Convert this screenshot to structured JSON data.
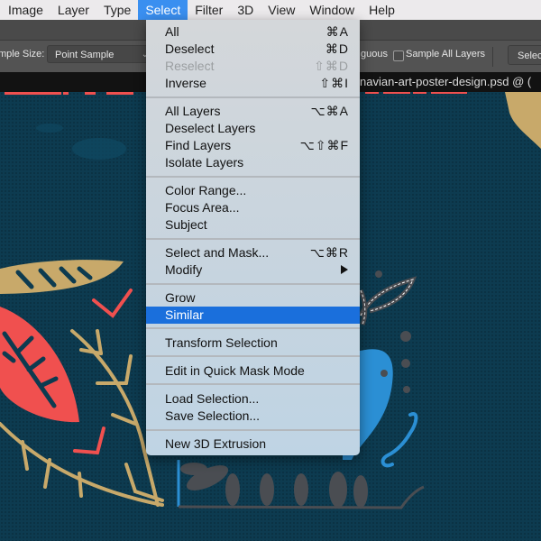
{
  "menubar": {
    "items": [
      {
        "label": "Image"
      },
      {
        "label": "Layer"
      },
      {
        "label": "Type"
      },
      {
        "label": "Select",
        "active": true
      },
      {
        "label": "Filter"
      },
      {
        "label": "3D"
      },
      {
        "label": "View"
      },
      {
        "label": "Window"
      },
      {
        "label": "Help"
      }
    ]
  },
  "options_bar": {
    "sample_size_label": "mple Size:",
    "sample_size_value": "Point Sample",
    "contiguous_label": "guous",
    "sample_all_layers_label": "Sample All Layers",
    "sample_all_layers_checked": false,
    "select_subject_button": "Selec"
  },
  "document": {
    "tab_title": "navian-art-poster-design.psd @ ("
  },
  "select_menu": {
    "items": [
      {
        "label": "All",
        "shortcut": "⌘A"
      },
      {
        "label": "Deselect",
        "shortcut": "⌘D"
      },
      {
        "label": "Reselect",
        "shortcut": "⇧⌘D",
        "disabled": true
      },
      {
        "label": "Inverse",
        "shortcut": "⇧⌘I"
      },
      {
        "label": "All Layers",
        "shortcut": "⌥⌘A"
      },
      {
        "label": "Deselect Layers",
        "shortcut": ""
      },
      {
        "label": "Find Layers",
        "shortcut": "⌥⇧⌘F"
      },
      {
        "label": "Isolate Layers",
        "shortcut": ""
      },
      {
        "label": "Color Range...",
        "shortcut": ""
      },
      {
        "label": "Focus Area...",
        "shortcut": ""
      },
      {
        "label": "Subject",
        "shortcut": ""
      },
      {
        "label": "Select and Mask...",
        "shortcut": "⌥⌘R"
      },
      {
        "label": "Modify",
        "shortcut": "",
        "submenu": true
      },
      {
        "label": "Grow",
        "shortcut": ""
      },
      {
        "label": "Similar",
        "shortcut": "",
        "highlighted": true
      },
      {
        "label": "Transform Selection",
        "shortcut": ""
      },
      {
        "label": "Edit in Quick Mask Mode",
        "shortcut": ""
      },
      {
        "label": "Load Selection...",
        "shortcut": ""
      },
      {
        "label": "Save Selection...",
        "shortcut": ""
      },
      {
        "label": "New 3D Extrusion",
        "shortcut": ""
      }
    ]
  },
  "colors": {
    "accent": "#1a6fdc",
    "menubar_active": "#3a8ff0",
    "canvas_bg": "#0d3b50",
    "coral": "#f0504f",
    "gold": "#c8a96a",
    "blue_shape": "#2b8fd4",
    "grey_shape": "#4a4d52"
  }
}
